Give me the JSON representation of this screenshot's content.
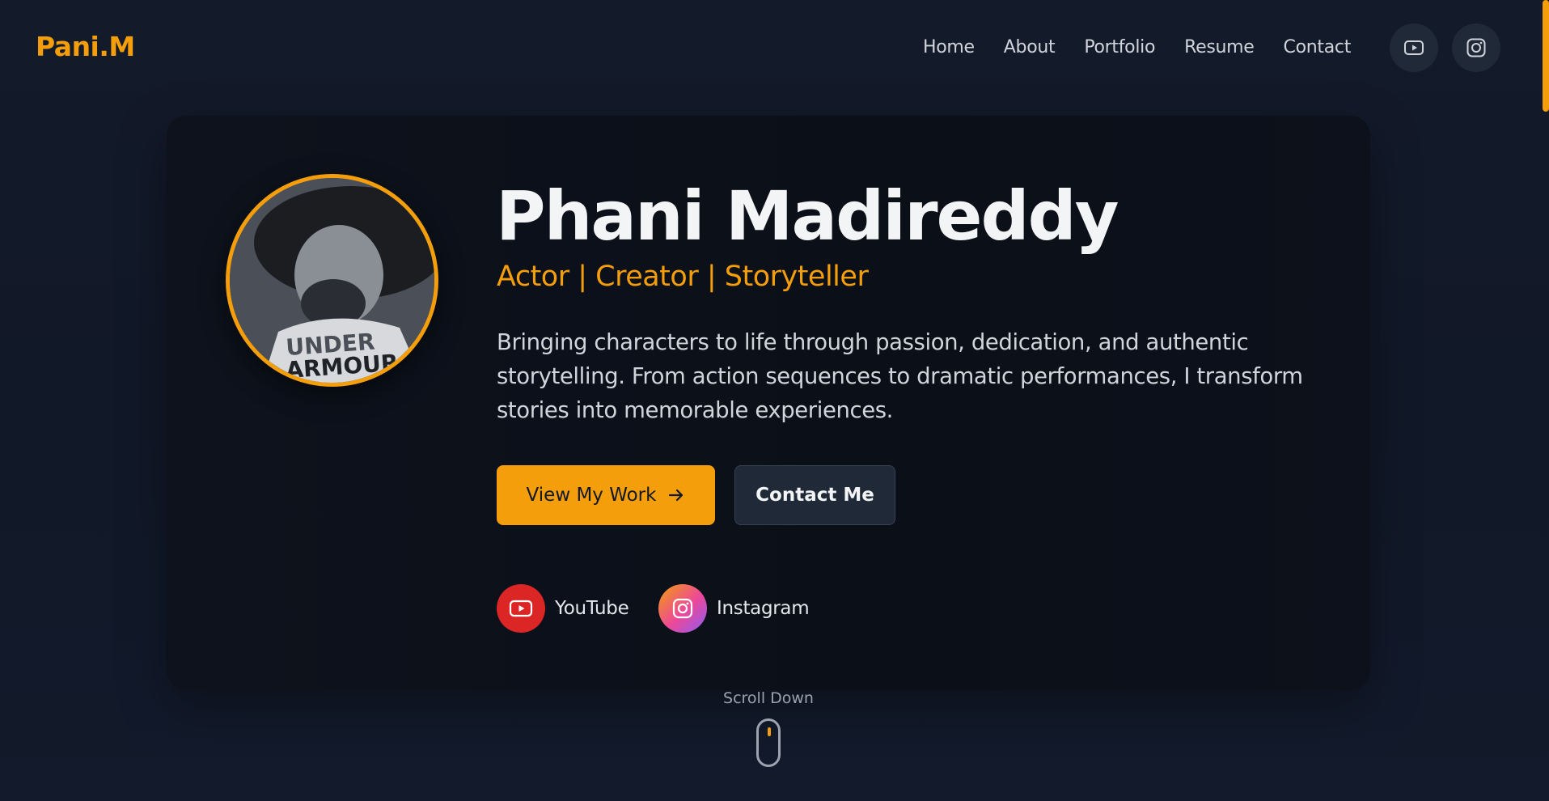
{
  "header": {
    "logo": "Pani.M",
    "nav": [
      "Home",
      "About",
      "Portfolio",
      "Resume",
      "Contact"
    ],
    "icons": [
      "youtube-icon",
      "instagram-icon"
    ]
  },
  "hero": {
    "name": "Phani Madireddy",
    "tagline": "Actor | Creator | Storyteller",
    "bio": "Bringing characters to life through passion, dedication, and authentic storytelling. From action sequences to dramatic performances, I transform stories into memorable experiences.",
    "primary_button": "View My Work",
    "secondary_button": "Contact Me",
    "social": [
      {
        "label": "YouTube",
        "icon": "youtube-icon",
        "color": "#dc2626"
      },
      {
        "label": "Instagram",
        "icon": "instagram-icon",
        "color": "#ec4899"
      }
    ]
  },
  "scroll_hint": "Scroll Down",
  "colors": {
    "accent": "#f59e0b",
    "background": "#111827",
    "card": "#0b0f18",
    "secondary_button": "#1f2937"
  }
}
